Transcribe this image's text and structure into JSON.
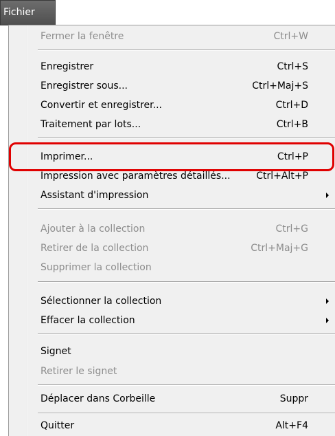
{
  "menubar": {
    "title": "Fichier"
  },
  "menu": {
    "items": [
      {
        "label": "Fermer la fenêtre",
        "shortcut": "Ctrl+W",
        "disabled": true
      },
      {
        "label": "Enregistrer",
        "shortcut": "Ctrl+S",
        "disabled": false
      },
      {
        "label": "Enregistrer sous...",
        "shortcut": "Ctrl+Maj+S",
        "disabled": false
      },
      {
        "label": "Convertir et enregistrer...",
        "shortcut": "Ctrl+D",
        "disabled": false
      },
      {
        "label": "Traitement par lots...",
        "shortcut": "Ctrl+B",
        "disabled": false
      },
      {
        "label": "Imprimer...",
        "shortcut": "Ctrl+P",
        "disabled": false,
        "highlighted": true
      },
      {
        "label": "Impression avec paramètres détaillés...",
        "shortcut": "Ctrl+Alt+P",
        "disabled": false
      },
      {
        "label": "Assistant d'impression",
        "shortcut": "",
        "disabled": false,
        "submenu": true
      },
      {
        "label": "Ajouter à la collection",
        "shortcut": "Ctrl+G",
        "disabled": true
      },
      {
        "label": "Retirer de la collection",
        "shortcut": "Ctrl+Maj+G",
        "disabled": true
      },
      {
        "label": "Supprimer la collection",
        "shortcut": "",
        "disabled": true
      },
      {
        "label": "Sélectionner la collection",
        "shortcut": "",
        "disabled": false,
        "submenu": true
      },
      {
        "label": "Effacer la collection",
        "shortcut": "",
        "disabled": false,
        "submenu": true
      },
      {
        "label": "Signet",
        "shortcut": "",
        "disabled": false
      },
      {
        "label": "Retirer le signet",
        "shortcut": "",
        "disabled": true
      },
      {
        "label": "Déplacer dans Corbeille",
        "shortcut": "Suppr",
        "disabled": false
      },
      {
        "label": "Quitter",
        "shortcut": "Alt+F4",
        "disabled": false
      }
    ]
  },
  "colors": {
    "highlight_border": "#e00000",
    "disabled_text": "#8c8c8c",
    "menu_background": "#f0f0f0"
  }
}
